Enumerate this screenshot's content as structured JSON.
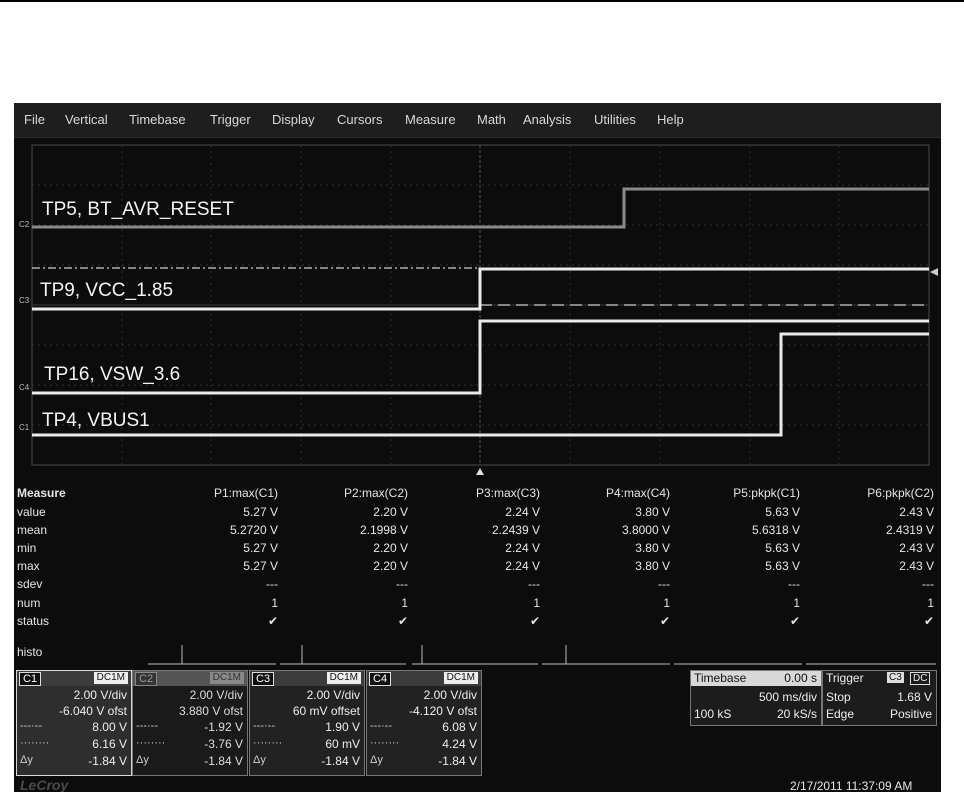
{
  "menu": [
    "File",
    "Vertical",
    "Timebase",
    "Trigger",
    "Display",
    "Cursors",
    "Measure",
    "Math",
    "Analysis",
    "Utilities",
    "Help"
  ],
  "traces": [
    {
      "label": "TP5, BT_AVR_RESET",
      "marker": "C2"
    },
    {
      "label": "TP9, VCC_1.85",
      "marker": "C3"
    },
    {
      "label": "TP16, VSW_3.6",
      "marker": "C4"
    },
    {
      "label": "TP4, VBUS1",
      "marker": "C1"
    }
  ],
  "measure": {
    "title": "Measure",
    "params": [
      "P1:max(C1)",
      "P2:max(C2)",
      "P3:max(C3)",
      "P4:max(C4)",
      "P5:pkpk(C1)",
      "P6:pkpk(C2)"
    ],
    "rows": [
      {
        "name": "value",
        "cells": [
          "5.27 V",
          "2.20 V",
          "2.24 V",
          "3.80 V",
          "5.63 V",
          "2.43 V"
        ]
      },
      {
        "name": "mean",
        "cells": [
          "5.2720 V",
          "2.1998 V",
          "2.2439 V",
          "3.8000 V",
          "5.6318 V",
          "2.4319 V"
        ]
      },
      {
        "name": "min",
        "cells": [
          "5.27 V",
          "2.20 V",
          "2.24 V",
          "3.80 V",
          "5.63 V",
          "2.43 V"
        ]
      },
      {
        "name": "max",
        "cells": [
          "5.27 V",
          "2.20 V",
          "2.24 V",
          "3.80 V",
          "5.63 V",
          "2.43 V"
        ]
      },
      {
        "name": "sdev",
        "cells": [
          "---",
          "---",
          "---",
          "---",
          "---",
          "---"
        ]
      },
      {
        "name": "num",
        "cells": [
          "1",
          "1",
          "1",
          "1",
          "1",
          "1"
        ]
      },
      {
        "name": "status",
        "cells": [
          "✔",
          "✔",
          "✔",
          "✔",
          "✔",
          "✔"
        ]
      }
    ],
    "histo_label": "histo"
  },
  "channels": [
    {
      "tag": "C1",
      "coupling": "DC1M",
      "vdiv": "2.00 V/div",
      "offset": "-6.040 V ofst",
      "r1": "8.00 V",
      "r2": "6.16 V",
      "dy": "-1.84 V"
    },
    {
      "tag": "C2",
      "coupling": "DC1M",
      "vdiv": "2.00 V/div",
      "offset": "3.880 V ofst",
      "r1": "-1.92 V",
      "r2": "-3.76 V",
      "dy": "-1.84 V"
    },
    {
      "tag": "C3",
      "coupling": "DC1M",
      "vdiv": "2.00 V/div",
      "offset": "60 mV offset",
      "r1": "1.90 V",
      "r2": "60 mV",
      "dy": "-1.84 V"
    },
    {
      "tag": "C4",
      "coupling": "DC1M",
      "vdiv": "2.00 V/div",
      "offset": "-4.120 V ofst",
      "r1": "6.08 V",
      "r2": "4.24 V",
      "dy": "-1.84 V"
    }
  ],
  "cursor_symbols": {
    "dash1": "---·--",
    "dash2": "········",
    "dy": "Δy"
  },
  "timebase": {
    "label": "Timebase",
    "delay": "0.00 s",
    "tdiv": "500 ms/div",
    "samples": "100 kS",
    "rate": "20 kS/s"
  },
  "trigger": {
    "label": "Trigger",
    "badge1": "C3",
    "badge2": "DC",
    "mode": "Stop",
    "level": "1.68 V",
    "type": "Edge",
    "slope": "Positive"
  },
  "brand": "LeCroy",
  "datetime": "2/17/2011 11:37:09 AM"
}
